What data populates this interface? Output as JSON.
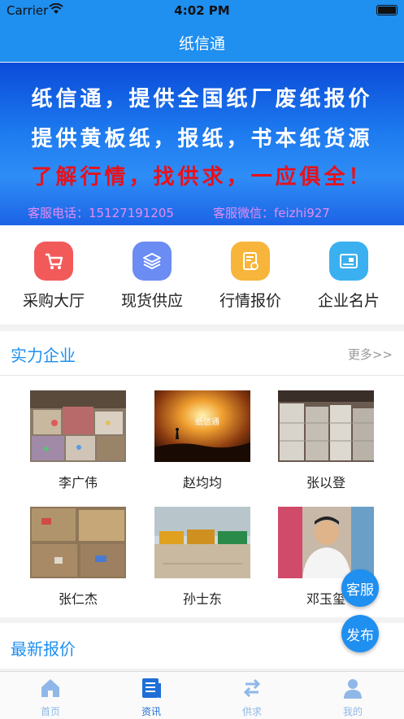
{
  "status_bar": {
    "carrier": "Carrier",
    "time": "4:02 PM"
  },
  "nav": {
    "title": "纸信通"
  },
  "banner": {
    "line1": "纸信通，提供全国纸厂废纸报价",
    "line2": "提供黄板纸，报纸，书本纸货源",
    "line3": "了解行情，找供求，一应俱全！",
    "phone": "客服电话：15127191205",
    "wechat": "客服微信：feizhi927"
  },
  "menu": {
    "items": [
      {
        "label": "采购大厅",
        "icon": "cart-icon",
        "color": "#f25a5a"
      },
      {
        "label": "现货供应",
        "icon": "layers-icon",
        "color": "#6b8cf2"
      },
      {
        "label": "行情报价",
        "icon": "price-document-icon",
        "color": "#f7b53b"
      },
      {
        "label": "企业名片",
        "icon": "business-card-icon",
        "color": "#3bb0f0"
      }
    ]
  },
  "companies": {
    "title": "实力企业",
    "more": "更多>>",
    "items": [
      {
        "name": "李广伟",
        "photo": "waste-paper-bales-photo"
      },
      {
        "name": "赵均均",
        "photo": "sunset-silhouette-photo",
        "photo_text": "纸信通"
      },
      {
        "name": "张以登",
        "photo": "warehouse-paper-stacks-photo"
      },
      {
        "name": "张仁杰",
        "photo": "cardboard-bales-photo"
      },
      {
        "name": "孙士东",
        "photo": "trucks-yard-photo"
      },
      {
        "name": "邓玉玺",
        "photo": "man-portrait-photo"
      }
    ]
  },
  "latest_prices": {
    "title": "最新报价"
  },
  "fab": {
    "service": "客服",
    "publish": "发布"
  },
  "tabbar": {
    "items": [
      {
        "label": "首页",
        "icon": "home-icon"
      },
      {
        "label": "资讯",
        "icon": "news-icon"
      },
      {
        "label": "供求",
        "icon": "exchange-icon"
      },
      {
        "label": "我的",
        "icon": "user-icon"
      }
    ]
  },
  "colors": {
    "primary": "#1f8ff0",
    "tab_inactive": "#8fb8e8",
    "tab_active": "#1f6fd6"
  }
}
